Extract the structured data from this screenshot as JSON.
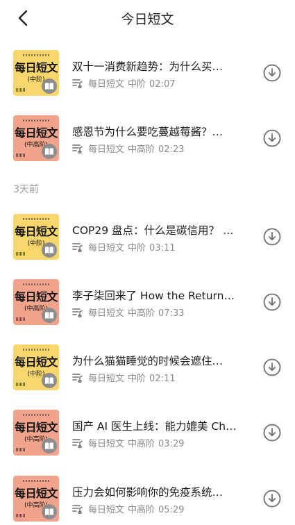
{
  "header": {
    "title": "今日短文"
  },
  "sections": [
    {
      "label": "3天前"
    }
  ],
  "items": [
    {
      "title": "双十一消费新趋势：为什么买…",
      "channel": "每日短文",
      "level": "中阶",
      "duration": "02:07",
      "cover": {
        "text": "每日短文",
        "level": "(中阶)",
        "bg": "#f7d66e"
      }
    },
    {
      "title": "感恩节为什么要吃蔓越莓酱？…",
      "channel": "每日短文",
      "level": "中高阶",
      "duration": "02:23",
      "cover": {
        "text": "每日短文",
        "level": "(中高阶)",
        "bg": "#f1a38b"
      }
    },
    {
      "title": "COP29 盘点：什么是碳信用？ …",
      "channel": "每日短文",
      "level": "中阶",
      "duration": "03:11",
      "cover": {
        "text": "每日短文",
        "level": "(中阶)",
        "bg": "#f7d66e"
      }
    },
    {
      "title": "李子柒回来了 How the Return…",
      "channel": "每日短文",
      "level": "中高阶",
      "duration": "07:33",
      "cover": {
        "text": "每日短文",
        "level": "(中高阶)",
        "bg": "#f1a38b"
      }
    },
    {
      "title": "为什么猫猫睡觉的时候会遮住…",
      "channel": "每日短文",
      "level": "中阶",
      "duration": "02:11",
      "cover": {
        "text": "每日短文",
        "level": "(中阶)",
        "bg": "#f7d66e"
      }
    },
    {
      "title": "国产 AI 医生上线：能力媲美 Ch…",
      "channel": "每日短文",
      "level": "中高阶",
      "duration": "03:29",
      "cover": {
        "text": "每日短文",
        "level": "(中高阶)",
        "bg": "#f1a38b"
      }
    },
    {
      "title": "压力会如何影响你的免疫系统…",
      "channel": "每日短文",
      "level": "中高阶",
      "duration": "05:29",
      "cover": {
        "text": "每日短文",
        "level": "(中高阶)",
        "bg": "#f1a38b"
      }
    }
  ],
  "icons": {
    "back": "chevron-left-icon",
    "meta": "playlist-icon",
    "download": "download-circle-icon",
    "book": "book-icon"
  },
  "colors": {
    "meta_text": "#8a8a8a",
    "icon_gray": "#6f6f6f",
    "cover_yellow": "#f7d66e",
    "cover_salmon": "#f1a38b"
  }
}
